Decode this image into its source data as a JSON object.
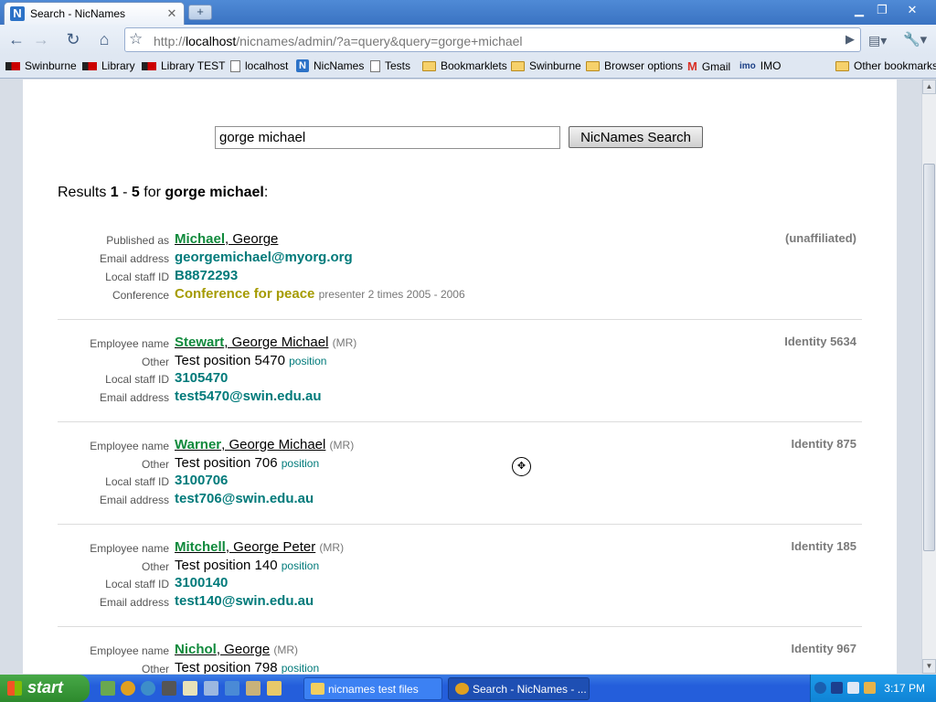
{
  "browser": {
    "tab_title": "Search - NicNames",
    "tab_icon_letter": "N",
    "url_prefix": "http://",
    "url_host": "localhost",
    "url_path": "/nicnames/admin/?a=query&query=gorge+michael"
  },
  "bookmarks": [
    {
      "label": "Swinburne",
      "icon": "swinburne-logo-icon"
    },
    {
      "label": "Library",
      "icon": "swinburne-logo-icon"
    },
    {
      "label": "Library TEST",
      "icon": "swinburne-logo-icon"
    },
    {
      "label": "localhost",
      "icon": "page-icon"
    },
    {
      "label": "NicNames",
      "icon": "nicnames-icon"
    },
    {
      "label": "Tests",
      "icon": "page-icon"
    },
    {
      "label": "Bookmarklets",
      "icon": "folder-icon"
    },
    {
      "label": "Swinburne",
      "icon": "folder-icon"
    },
    {
      "label": "Browser options",
      "icon": "folder-icon"
    },
    {
      "label": "Gmail",
      "icon": "gmail-icon"
    },
    {
      "label": "IMO",
      "icon": "imo-icon"
    },
    {
      "label": "Other bookmarks",
      "icon": "folder-icon"
    }
  ],
  "search": {
    "query_value": "gorge michael",
    "button_label": "NicNames Search"
  },
  "summary": {
    "prefix": "Results ",
    "from": "1",
    "sep": " - ",
    "to": "5",
    "mid": " for ",
    "query": "gorge michael",
    "suffix": ":"
  },
  "results": [
    {
      "side_label": "(unaffiliated)",
      "name_label": "Published as",
      "surname": "Michael",
      "given": ", George",
      "title": "",
      "email_label": "Email address",
      "email": "georgemichael@myorg.org",
      "staff_label": "Local staff ID",
      "staff_id": "B8872293",
      "conf_label": "Conference",
      "conf_value": "Conference for peace",
      "conf_note": "presenter 2 times 2005 - 2006"
    },
    {
      "side_label": "Identity 5634",
      "name_label": "Employee name",
      "surname": "Stewart",
      "given": ", George Michael",
      "title": "(MR)",
      "other_label": "Other",
      "other_value": "Test position 5470",
      "other_note": "position",
      "staff_label": "Local staff ID",
      "staff_id": "3105470",
      "email_label": "Email address",
      "email": "test5470@swin.edu.au"
    },
    {
      "side_label": "Identity 875",
      "name_label": "Employee name",
      "surname": "Warner",
      "given": ", George Michael",
      "title": "(MR)",
      "other_label": "Other",
      "other_value": "Test position 706",
      "other_note": "position",
      "staff_label": "Local staff ID",
      "staff_id": "3100706",
      "email_label": "Email address",
      "email": "test706@swin.edu.au"
    },
    {
      "side_label": "Identity 185",
      "name_label": "Employee name",
      "surname": "Mitchell",
      "given": ", George Peter",
      "title": "(MR)",
      "other_label": "Other",
      "other_value": "Test position 140",
      "other_note": "position",
      "staff_label": "Local staff ID",
      "staff_id": "3100140",
      "email_label": "Email address",
      "email": "test140@swin.edu.au"
    },
    {
      "side_label": "Identity 967",
      "name_label": "Employee name",
      "surname": "Nichol",
      "given": ", George",
      "title": "(MR)",
      "other_label": "Other",
      "other_value": "Test position 798",
      "other_note": "position"
    }
  ],
  "taskbar": {
    "start_label": "start",
    "tasks": [
      {
        "label": "nicnames test files"
      },
      {
        "label": "Search - NicNames - ..."
      }
    ],
    "clock": "3:17 PM"
  }
}
